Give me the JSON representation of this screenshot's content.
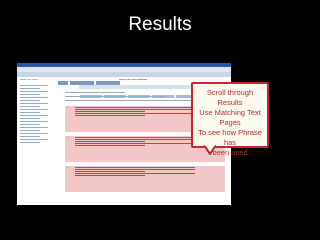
{
  "slide": {
    "title": "Results",
    "callout_lines": [
      "Scroll through Results",
      "Use  Matching Text Pages",
      "To see how Phrase has",
      "been used"
    ]
  },
  "browser": {
    "page_heading": "Search Lexis Nexis Academic",
    "sidebar_heading": "Narrow Your Search",
    "result_labels": [
      "1.",
      "2.",
      "3."
    ]
  },
  "colors": {
    "background": "#000000",
    "callout_border": "#c02a2a",
    "callout_text": "#c02a2a",
    "result_highlight": "#f4c7c7"
  }
}
